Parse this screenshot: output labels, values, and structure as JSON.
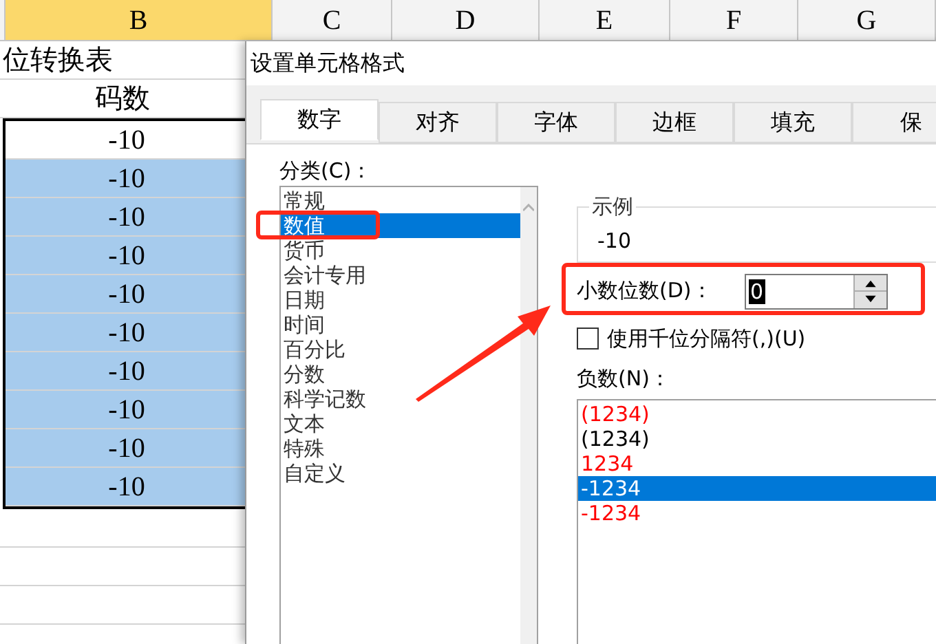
{
  "sheet": {
    "column_headers": [
      {
        "label": "B",
        "selected": true
      },
      {
        "label": "C",
        "selected": false
      },
      {
        "label": "D",
        "selected": false
      },
      {
        "label": "E",
        "selected": false
      },
      {
        "label": "F",
        "selected": false
      },
      {
        "label": "G",
        "selected": false
      }
    ],
    "title": "位转换表",
    "header": "码数",
    "cells": [
      {
        "value": "-10",
        "selected": false
      },
      {
        "value": "-10",
        "selected": true
      },
      {
        "value": "-10",
        "selected": true
      },
      {
        "value": "-10",
        "selected": true
      },
      {
        "value": "-10",
        "selected": true
      },
      {
        "value": "-10",
        "selected": true
      },
      {
        "value": "-10",
        "selected": true
      },
      {
        "value": "-10",
        "selected": true
      },
      {
        "value": "-10",
        "selected": true
      },
      {
        "value": "-10",
        "selected": true
      }
    ]
  },
  "dialog": {
    "title": "设置单元格格式",
    "tabs": [
      {
        "label": "数字",
        "selected": true
      },
      {
        "label": "对齐",
        "selected": false
      },
      {
        "label": "字体",
        "selected": false
      },
      {
        "label": "边框",
        "selected": false
      },
      {
        "label": "填充",
        "selected": false
      },
      {
        "label": "保",
        "selected": false
      }
    ],
    "category_label": "分类(C)：",
    "categories": [
      {
        "label": "常规",
        "selected": false
      },
      {
        "label": "数值",
        "selected": true
      },
      {
        "label": "货币",
        "selected": false
      },
      {
        "label": "会计专用",
        "selected": false
      },
      {
        "label": "日期",
        "selected": false
      },
      {
        "label": "时间",
        "selected": false
      },
      {
        "label": "百分比",
        "selected": false
      },
      {
        "label": "分数",
        "selected": false
      },
      {
        "label": "科学记数",
        "selected": false
      },
      {
        "label": "文本",
        "selected": false
      },
      {
        "label": "特殊",
        "selected": false
      },
      {
        "label": "自定义",
        "selected": false
      }
    ],
    "sample_label": "示例",
    "sample_value": "-10",
    "decimal_label": "小数位数(D)：",
    "decimal_value": "0",
    "thousands": {
      "label": "使用千位分隔符(,)(U)",
      "checked": false
    },
    "negative_label": "负数(N)：",
    "negative_formats": [
      {
        "label": "(1234)",
        "color": "#ff0000",
        "selected": false
      },
      {
        "label": "(1234)",
        "color": "#000000",
        "selected": false
      },
      {
        "label": "1234",
        "color": "#ff0000",
        "selected": false
      },
      {
        "label": "-1234",
        "selected": true
      },
      {
        "label": "-1234",
        "color": "#ff0000",
        "selected": false
      }
    ]
  }
}
